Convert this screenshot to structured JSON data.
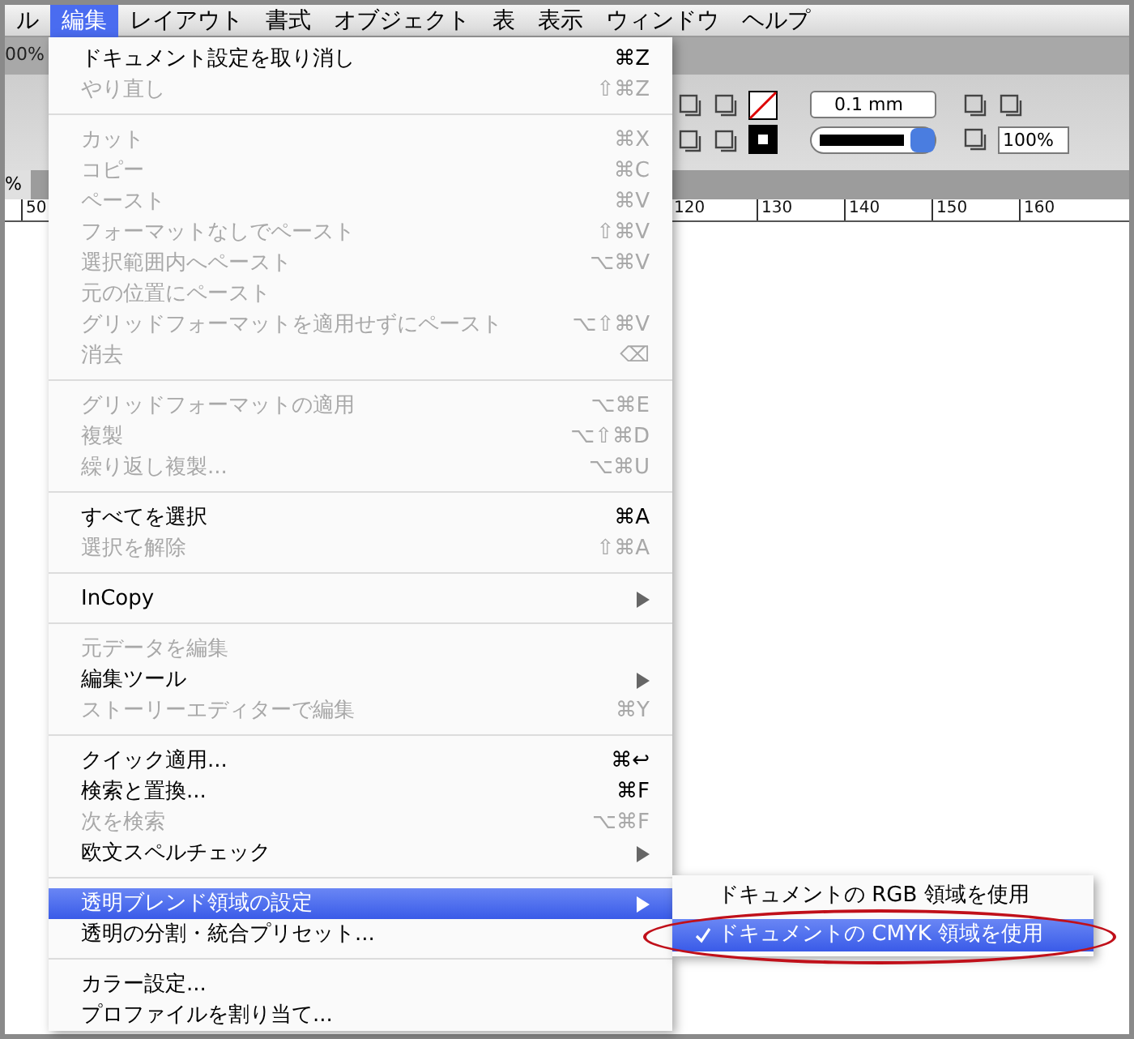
{
  "menubar": {
    "items": [
      {
        "label": "ル",
        "selected": false
      },
      {
        "label": "編集",
        "selected": true
      },
      {
        "label": "レイアウト",
        "selected": false
      },
      {
        "label": "書式",
        "selected": false
      },
      {
        "label": "オブジェクト",
        "selected": false
      },
      {
        "label": "表",
        "selected": false
      },
      {
        "label": "表示",
        "selected": false
      },
      {
        "label": "ウィンドウ",
        "selected": false
      },
      {
        "label": "ヘルプ",
        "selected": false
      }
    ]
  },
  "toolbar": {
    "zoom": "00%",
    "stroke_weight": "0.1 mm",
    "opacity": "100%",
    "tab": "%"
  },
  "ruler": {
    "left_label": "50",
    "labels": [
      "120",
      "130",
      "140",
      "150",
      "160"
    ]
  },
  "menu": {
    "sections": [
      [
        {
          "label": "ドキュメント設定を取り消し",
          "shortcut": "⌘Z",
          "disabled": false,
          "submenu": false,
          "selected": false
        },
        {
          "label": "やり直し",
          "shortcut": "⇧⌘Z",
          "disabled": true,
          "submenu": false,
          "selected": false
        }
      ],
      [
        {
          "label": "カット",
          "shortcut": "⌘X",
          "disabled": true,
          "submenu": false,
          "selected": false
        },
        {
          "label": "コピー",
          "shortcut": "⌘C",
          "disabled": true,
          "submenu": false,
          "selected": false
        },
        {
          "label": "ペースト",
          "shortcut": "⌘V",
          "disabled": true,
          "submenu": false,
          "selected": false
        },
        {
          "label": "フォーマットなしでペースト",
          "shortcut": "⇧⌘V",
          "disabled": true,
          "submenu": false,
          "selected": false
        },
        {
          "label": "選択範囲内へペースト",
          "shortcut": "⌥⌘V",
          "disabled": true,
          "submenu": false,
          "selected": false
        },
        {
          "label": "元の位置にペースト",
          "disabled": true,
          "submenu": false,
          "selected": false
        },
        {
          "label": "グリッドフォーマットを適用せずにペースト",
          "shortcut": "⌥⇧⌘V",
          "disabled": true,
          "submenu": false,
          "selected": false
        },
        {
          "label": "消去",
          "shortcut": "⌫",
          "disabled": true,
          "submenu": false,
          "selected": false
        }
      ],
      [
        {
          "label": "グリッドフォーマットの適用",
          "shortcut": "⌥⌘E",
          "disabled": true,
          "submenu": false,
          "selected": false
        },
        {
          "label": "複製",
          "shortcut": "⌥⇧⌘D",
          "disabled": true,
          "submenu": false,
          "selected": false
        },
        {
          "label": "繰り返し複製...",
          "shortcut": "⌥⌘U",
          "disabled": true,
          "submenu": false,
          "selected": false
        }
      ],
      [
        {
          "label": "すべてを選択",
          "shortcut": "⌘A",
          "disabled": false,
          "submenu": false,
          "selected": false
        },
        {
          "label": "選択を解除",
          "shortcut": "⇧⌘A",
          "disabled": true,
          "submenu": false,
          "selected": false
        }
      ],
      [
        {
          "label": "InCopy",
          "disabled": false,
          "submenu": true,
          "selected": false
        }
      ],
      [
        {
          "label": "元データを編集",
          "disabled": true,
          "submenu": false,
          "selected": false
        },
        {
          "label": "編集ツール",
          "disabled": false,
          "submenu": true,
          "selected": false
        },
        {
          "label": "ストーリーエディターで編集",
          "shortcut": "⌘Y",
          "disabled": true,
          "submenu": false,
          "selected": false
        }
      ],
      [
        {
          "label": "クイック適用...",
          "shortcut": "⌘↩",
          "disabled": false,
          "submenu": false,
          "selected": false
        },
        {
          "label": "検索と置換...",
          "shortcut": "⌘F",
          "disabled": false,
          "submenu": false,
          "selected": false
        },
        {
          "label": "次を検索",
          "shortcut": "⌥⌘F",
          "disabled": true,
          "submenu": false,
          "selected": false
        },
        {
          "label": "欧文スペルチェック",
          "disabled": false,
          "submenu": true,
          "selected": false
        }
      ],
      [
        {
          "label": "透明ブレンド領域の設定",
          "disabled": false,
          "submenu": true,
          "selected": true
        },
        {
          "label": "透明の分割・統合プリセット...",
          "disabled": false,
          "submenu": false,
          "selected": false
        }
      ],
      [
        {
          "label": "カラー設定...",
          "disabled": false,
          "submenu": false,
          "selected": false
        },
        {
          "label": "プロファイルを割り当て...",
          "disabled": false,
          "submenu": false,
          "selected": false
        }
      ]
    ]
  },
  "submenu": {
    "items": [
      {
        "label": "ドキュメントの RGB 領域を使用",
        "checked": false,
        "selected": false
      },
      {
        "label": "ドキュメントの CMYK 領域を使用",
        "checked": true,
        "selected": true
      }
    ]
  }
}
